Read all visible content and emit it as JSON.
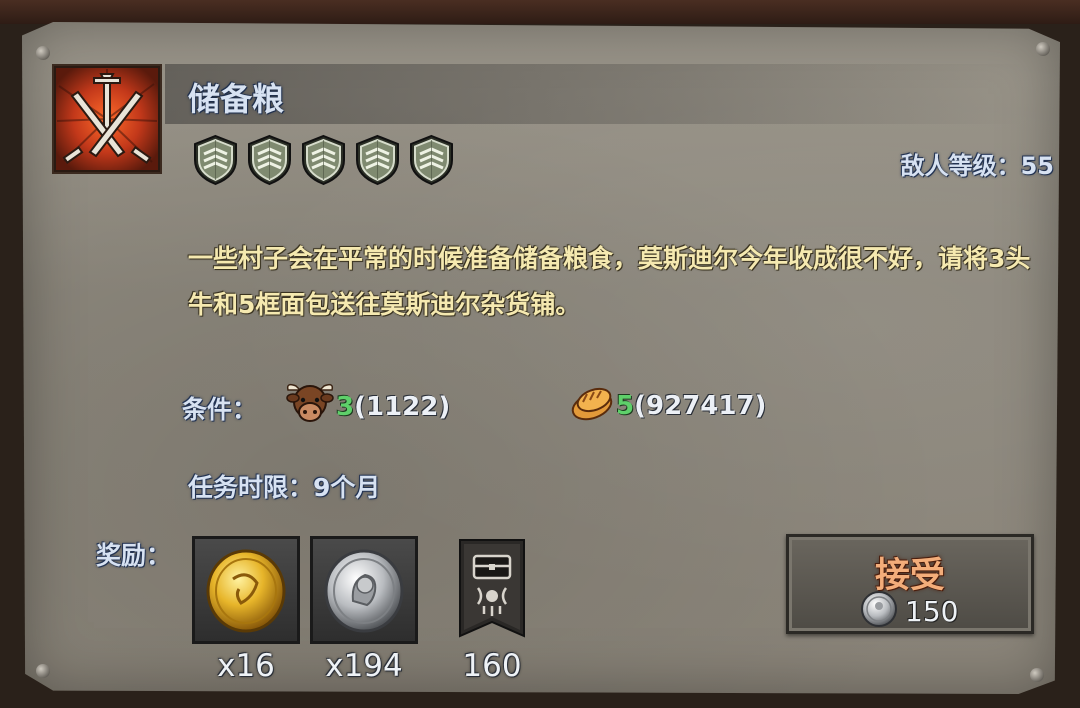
{
  "quest": {
    "title": "储备粮",
    "difficulty_shields": 5,
    "enemy_level_label": "敌人等级：55",
    "description": "一些村子会在平常的时候准备储备粮食，莫斯迪尔今年收成很不好，请将3头牛和5框面包送往莫斯迪尔杂货铺。",
    "conditions_label": "条件：",
    "conditions": [
      {
        "icon": "cow-icon",
        "required": "3",
        "owned": "(1122)"
      },
      {
        "icon": "bread-icon",
        "required": "5",
        "owned": "(927417)"
      }
    ],
    "time_limit_label": "任务时限：9个月",
    "rewards_label": "奖励：",
    "rewards": [
      {
        "icon": "gold-coin-icon",
        "count": "x16"
      },
      {
        "icon": "silver-coin-icon",
        "count": "x194"
      },
      {
        "icon": "chest-banner-icon",
        "count": "160"
      }
    ],
    "accept_button": {
      "label": "接受",
      "cost_icon": "silver-coin-icon",
      "cost": "150"
    }
  },
  "colors": {
    "title_text": "#d7e2f2",
    "description_text": "#f5e9b0",
    "required_green": "#5ed06a",
    "accept_text": "#f3ad7a"
  }
}
